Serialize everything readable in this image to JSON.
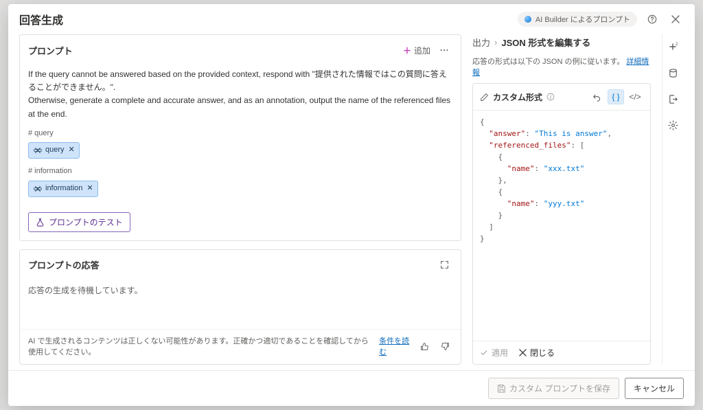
{
  "header": {
    "title": "回答生成",
    "ai_badge": "AI Builder によるプロンプト"
  },
  "prompt": {
    "title": "プロンプト",
    "add_label": "追加",
    "text_line1": "If the query cannot be answered based on the provided context, respond with \"提供された情報ではこの質問に答えることができません。\".",
    "text_line2": "Otherwise, generate a complete and accurate answer, and as an annotation, output the name of the referenced files at the end.",
    "var_query_label": "# query",
    "var_query_chip": "query",
    "var_info_label": "# information",
    "var_info_chip": "information",
    "test_button": "プロンプトのテスト"
  },
  "response": {
    "title": "プロンプトの応答",
    "waiting": "応答の生成を待機しています。",
    "disclaimer": "AI で生成されるコンテンツは正しくない可能性があります。正確かつ適切であることを確認してから使用してください。",
    "terms_link": "条件を読む"
  },
  "output": {
    "breadcrumb_root": "出力",
    "breadcrumb_leaf": "JSON 形式を編集する",
    "info_text": "応答の形式は以下の JSON の例に従います。",
    "info_link": "詳細情報",
    "format_title": "カスタム形式",
    "apply_label": "適用",
    "close_label": "閉じる"
  },
  "chart_data": {
    "type": "table",
    "title": "JSON response schema example",
    "json_example": {
      "answer": "This is answer",
      "referenced_files": [
        {
          "name": "xxx.txt"
        },
        {
          "name": "yyy.txt"
        }
      ]
    }
  },
  "footer": {
    "save_label": "カスタム プロンプトを保存",
    "cancel_label": "キャンセル"
  }
}
